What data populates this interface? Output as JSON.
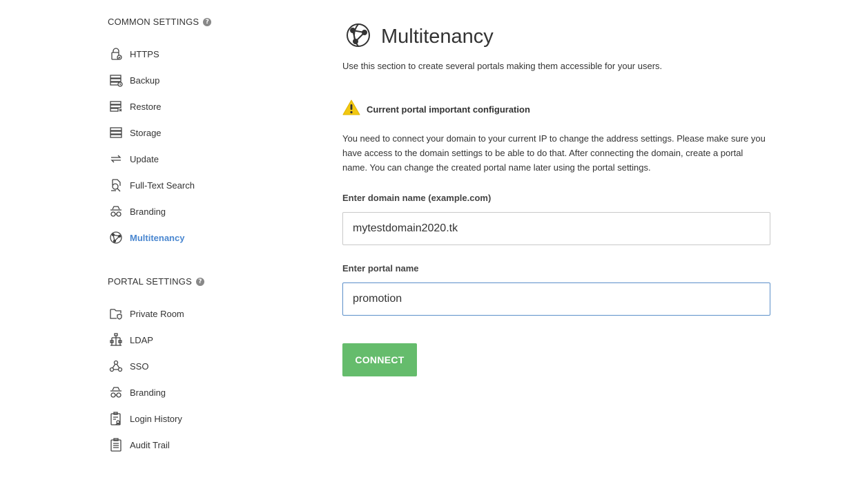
{
  "sidebar": {
    "common_heading": "COMMON SETTINGS",
    "common_items": [
      {
        "label": "HTTPS",
        "icon": "lock-icon"
      },
      {
        "label": "Backup",
        "icon": "backup-icon"
      },
      {
        "label": "Restore",
        "icon": "restore-icon"
      },
      {
        "label": "Storage",
        "icon": "storage-icon"
      },
      {
        "label": "Update",
        "icon": "update-icon"
      },
      {
        "label": "Full-Text Search",
        "icon": "search-doc-icon"
      },
      {
        "label": "Branding",
        "icon": "branding-icon"
      },
      {
        "label": "Multitenancy",
        "icon": "globe-icon"
      }
    ],
    "portal_heading": "PORTAL SETTINGS",
    "portal_items": [
      {
        "label": "Private Room",
        "icon": "folder-shield-icon"
      },
      {
        "label": "LDAP",
        "icon": "ldap-icon"
      },
      {
        "label": "SSO",
        "icon": "sso-icon"
      },
      {
        "label": "Branding",
        "icon": "branding-icon"
      },
      {
        "label": "Login History",
        "icon": "login-history-icon"
      },
      {
        "label": "Audit Trail",
        "icon": "audit-trail-icon"
      }
    ]
  },
  "main": {
    "title": "Multitenancy",
    "description": "Use this section to create several portals making them accessible for your users.",
    "warning_title": "Current portal important configuration",
    "info_text": "You need to connect your domain to your current IP to change the address settings. Please make sure you have access to the domain settings to be able to do that. After connecting the domain, create a portal name. You can change the created portal name later using the portal settings.",
    "domain_label": "Enter domain name (example.com)",
    "domain_value": "mytestdomain2020.tk",
    "portal_label": "Enter portal name",
    "portal_value": "promotion",
    "connect_label": "CONNECT"
  },
  "colors": {
    "accent": "#4a87d0",
    "connect_button": "#65bc6c",
    "warning": "#f2c811"
  }
}
